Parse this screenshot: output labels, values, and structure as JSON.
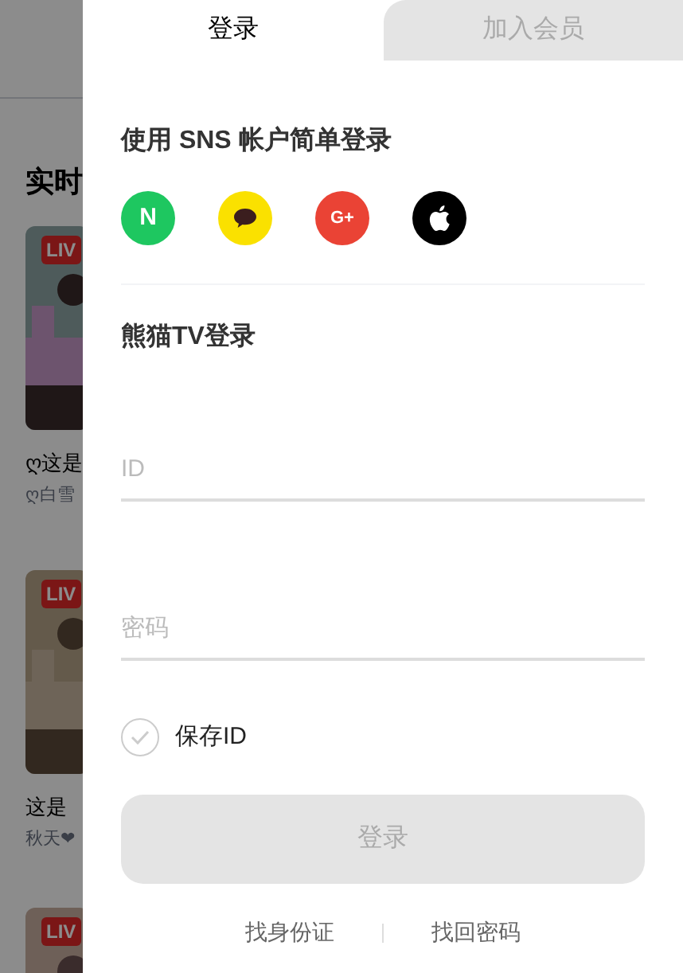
{
  "background": {
    "heading": "实时",
    "cards": [
      {
        "badge": "LIV",
        "title": "ღ这是",
        "author": "ღ白雪"
      },
      {
        "badge": "LIV",
        "title": "这是",
        "author": "秋天❤"
      },
      {
        "badge": "LIV"
      }
    ]
  },
  "tabs": [
    {
      "label": "登录",
      "selected": true
    },
    {
      "label": "加入会员",
      "selected": false
    }
  ],
  "sns": {
    "title": "使用 SNS 帐户简单登录",
    "buttons": [
      {
        "kind": "naver",
        "label": "N"
      },
      {
        "kind": "kakao"
      },
      {
        "kind": "google",
        "label": "G+"
      },
      {
        "kind": "apple"
      }
    ]
  },
  "login": {
    "title": "熊猫TV登录",
    "fields": [
      {
        "placeholder": "ID"
      },
      {
        "placeholder": "密码"
      }
    ],
    "save_id": {
      "label": "保存ID",
      "checked": false
    },
    "button": {
      "label": "登录",
      "disabled": true
    },
    "links": [
      "找身份证",
      "找回密码"
    ]
  }
}
